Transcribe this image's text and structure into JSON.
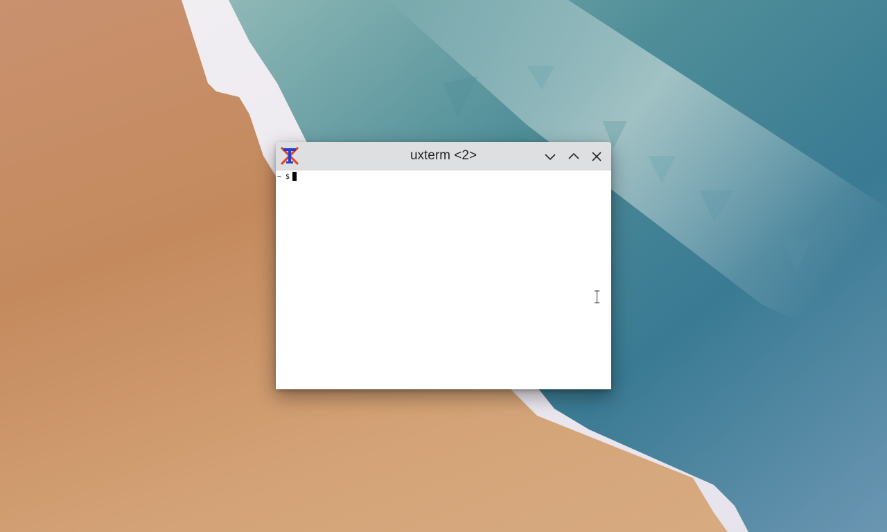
{
  "window": {
    "title": "uxterm <2>",
    "app_icon": "xterm-icon",
    "buttons": {
      "minimize": "chevron-down-icon",
      "maximize": "chevron-up-icon",
      "close": "close-icon"
    }
  },
  "terminal": {
    "prompt": "~ $"
  },
  "colors": {
    "titlebar": "#dedfe1",
    "terminal_bg": "#ffffff",
    "text": "#000000"
  }
}
